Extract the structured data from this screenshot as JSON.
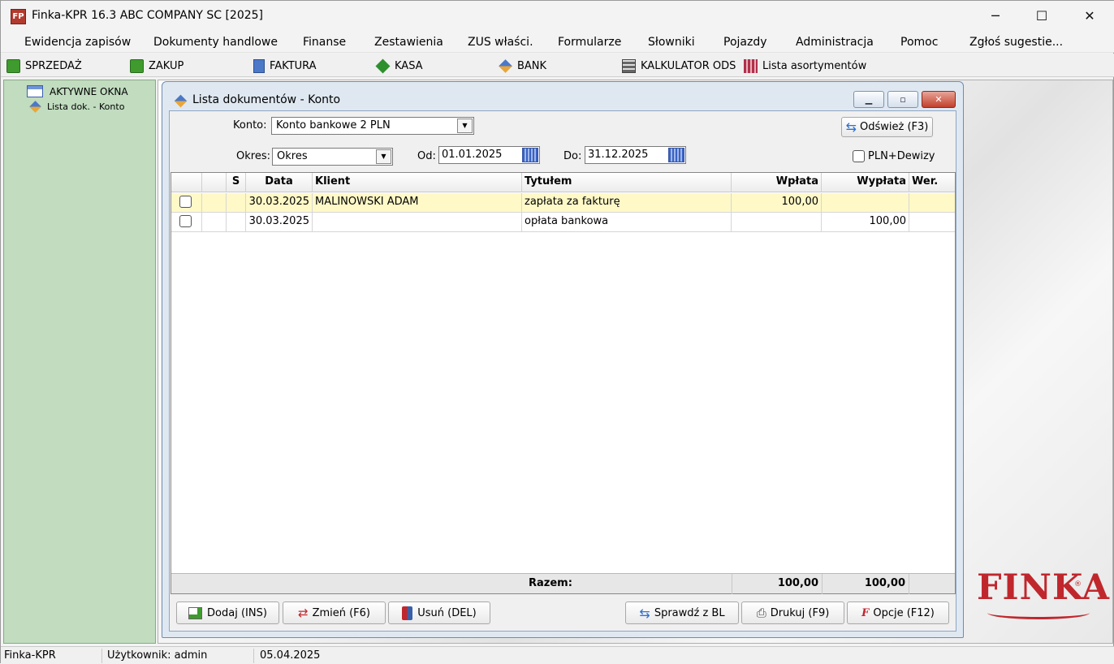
{
  "window": {
    "title": "Finka-KPR 16.3 ABC COMPANY SC [2025]",
    "icon_text": "FP",
    "controls": {
      "minimize": "─",
      "maximize": "☐",
      "close": "✕"
    }
  },
  "menu": [
    {
      "label": "Ewidencja zapisów"
    },
    {
      "label": "Dokumenty handlowe"
    },
    {
      "label": "Finanse"
    },
    {
      "label": "Zestawienia"
    },
    {
      "label": "ZUS właści."
    },
    {
      "label": "Formularze"
    },
    {
      "label": "Słowniki"
    },
    {
      "label": "Pojazdy"
    },
    {
      "label": "Administracja"
    },
    {
      "label": "Pomoc"
    },
    {
      "label": "Zgłoś sugestie..."
    }
  ],
  "toolbar": [
    {
      "label": "SPRZEDAŻ",
      "icon": "sales-icon",
      "color": "#3f9b2e"
    },
    {
      "label": "ZAKUP",
      "icon": "purchase-icon",
      "color": "#3f9b2e"
    },
    {
      "label": "FAKTURA",
      "icon": "invoice-icon",
      "color": "#4b79c8"
    },
    {
      "label": "KASA",
      "icon": "cash-icon",
      "color": "#2f8f2f"
    },
    {
      "label": "BANK",
      "icon": "bank-icon",
      "color": "#4b79c8"
    },
    {
      "label": "KALKULATOR ODS",
      "icon": "calculator-icon",
      "color": "#555555"
    },
    {
      "label": "Lista asortymentów",
      "icon": "assortment-icon",
      "color": "#b0304a"
    }
  ],
  "sidebar": {
    "root": "AKTYWNE OKNA",
    "child": "Lista dok. - Konto"
  },
  "mdi": {
    "title": "Lista dokumentów - Konto",
    "konto_label": "Konto:",
    "konto_value": "Konto bankowe 2 PLN",
    "refresh_label": "Odśwież (F3)",
    "okres_label": "Okres:",
    "okres_value": "Okres",
    "od_label": "Od:",
    "od_value": "01.01.2025",
    "do_label": "Do:",
    "do_value": "31.12.2025",
    "pln_label": "PLN+Dewizy"
  },
  "grid": {
    "columns": [
      "S",
      "Data",
      "Klient",
      "Tytułem",
      "Wpłata",
      "Wypłata",
      "Wer."
    ],
    "rows": [
      {
        "data": "30.03.2025",
        "klient": "MALINOWSKI ADAM",
        "tytulem": "zapłata za fakturę",
        "wplata": "100,00",
        "wyplata": ""
      },
      {
        "data": "30.03.2025",
        "klient": "",
        "tytulem": "opłata bankowa",
        "wplata": "",
        "wyplata": "100,00"
      }
    ],
    "footer": {
      "label": "Razem:",
      "wplata": "100,00",
      "wyplata": "100,00"
    }
  },
  "buttons": {
    "add": "Dodaj (INS)",
    "edit": "Zmień (F6)",
    "delete": "Usuń (DEL)",
    "check": "Sprawdź z BL",
    "print": "Drukuj (F9)",
    "options": "Opcje (F12)"
  },
  "logo": {
    "text": "FINKA",
    "mark": "®",
    "color": "#c0272d"
  },
  "status": {
    "app": "Finka-KPR",
    "user": "Użytkownik: admin",
    "date": "05.04.2025"
  },
  "colors": {
    "selected_row": "#fff9c8",
    "sidebar": "#c1dcbf",
    "accent": "#c0272d"
  }
}
